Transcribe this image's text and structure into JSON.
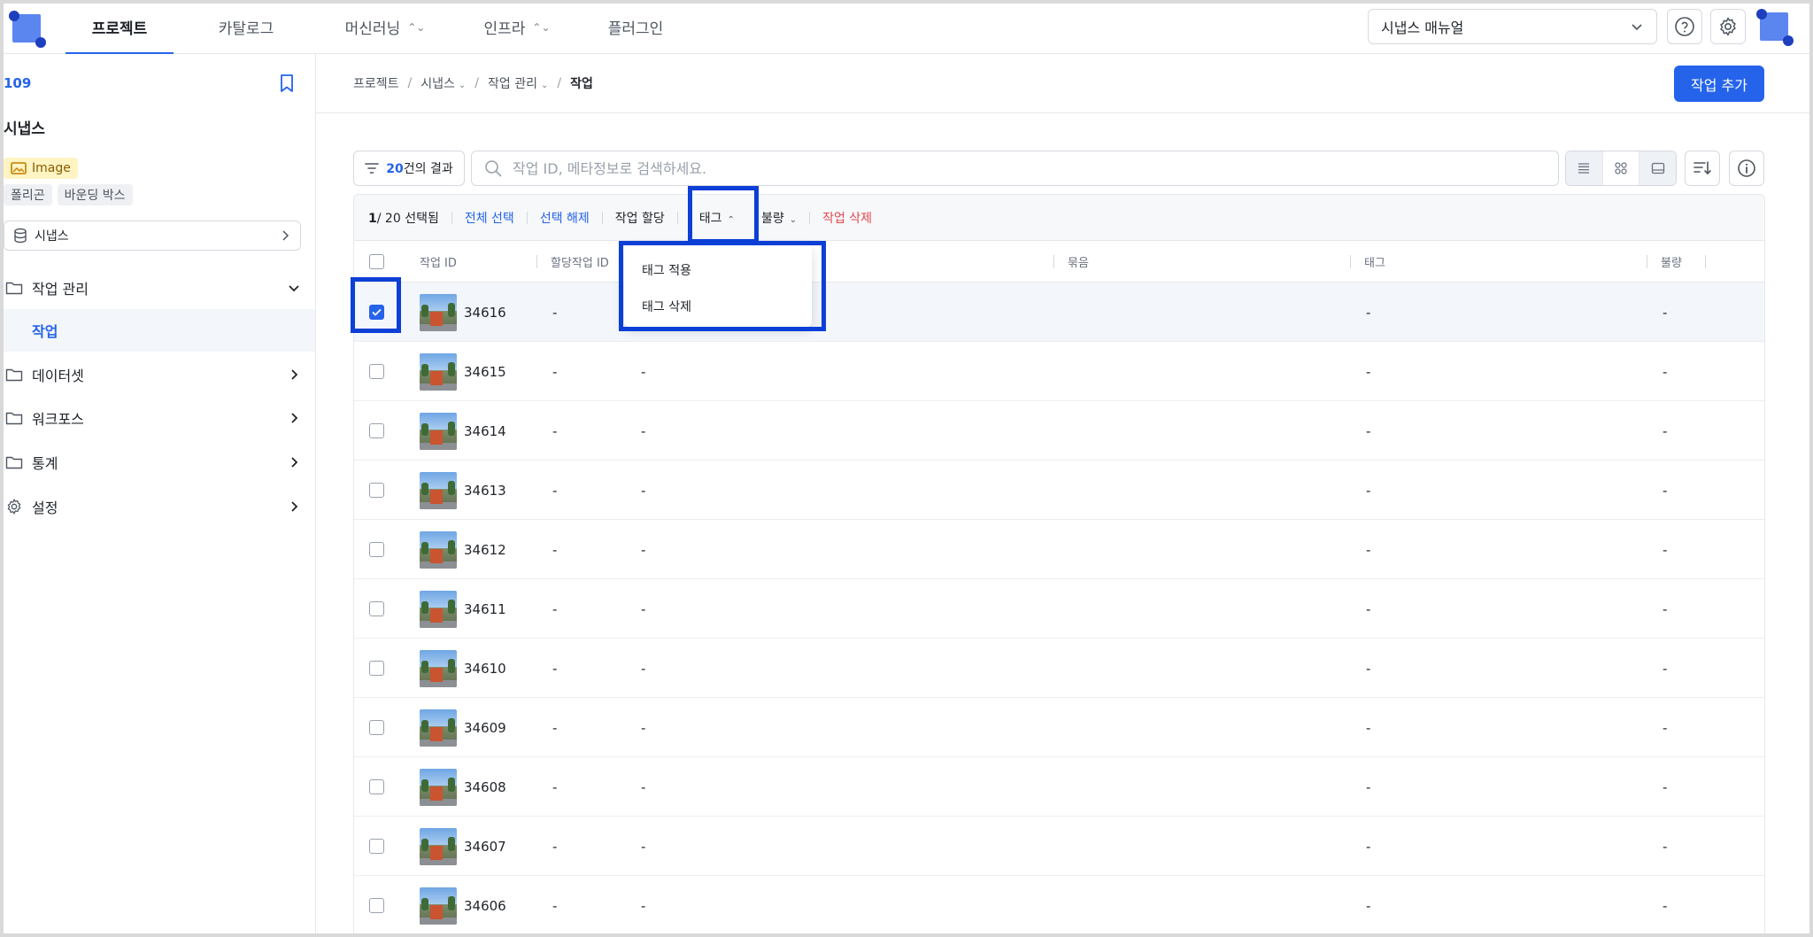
{
  "topnav": {
    "items": [
      {
        "label": "프로젝트",
        "active": true,
        "dropdown": false
      },
      {
        "label": "카탈로그",
        "active": false,
        "dropdown": false
      },
      {
        "label": "머신러닝",
        "active": false,
        "dropdown": true
      },
      {
        "label": "인프라",
        "active": false,
        "dropdown": true
      },
      {
        "label": "플러그인",
        "active": false,
        "dropdown": false
      }
    ],
    "workspace": "시냅스 매뉴얼",
    "help_icon": "question-circle-icon",
    "settings_icon": "gear-icon"
  },
  "sidebar": {
    "project_id": "109",
    "project_name": "시냅스",
    "data_type_badge": "Image",
    "annotation_types": [
      "폴리곤",
      "바운딩 박스"
    ],
    "dataset": "시냅스",
    "menu": [
      {
        "label": "작업 관리",
        "icon": "folder-icon",
        "expanded": true
      },
      {
        "label": "데이터셋",
        "icon": "folder-icon",
        "expanded": false
      },
      {
        "label": "워크포스",
        "icon": "folder-icon",
        "expanded": false
      },
      {
        "label": "통계",
        "icon": "folder-icon",
        "expanded": false
      },
      {
        "label": "설정",
        "icon": "gear-icon",
        "expanded": false
      }
    ],
    "submenu_active": "작업"
  },
  "breadcrumb": {
    "items": [
      "프로젝트",
      "시냅스",
      "작업 관리",
      "작업"
    ]
  },
  "header": {
    "add_button": "작업 추가"
  },
  "filter": {
    "count": "20",
    "suffix": "건의 결과"
  },
  "search": {
    "placeholder": "작업 ID, 메타정보로 검색하세요."
  },
  "actionbar": {
    "selected": "1",
    "total": "/ 20",
    "selected_suffix": "선택됨",
    "select_all": "전체 선택",
    "deselect": "선택 해제",
    "assign": "작업 할당",
    "tag": "태그",
    "defect": "불량",
    "delete": "작업 삭제"
  },
  "table": {
    "headers": {
      "id": "작업 ID",
      "assigned": "할당작업 ID",
      "bundle": "묶음",
      "tag": "태그",
      "defect": "불량"
    },
    "rows": [
      {
        "id": "34616",
        "assigned": "-",
        "col3": "",
        "tag": "-",
        "defect": "-",
        "checked": true
      },
      {
        "id": "34615",
        "assigned": "-",
        "col3": "-",
        "tag": "-",
        "defect": "-",
        "checked": false
      },
      {
        "id": "34614",
        "assigned": "-",
        "col3": "-",
        "tag": "-",
        "defect": "-",
        "checked": false
      },
      {
        "id": "34613",
        "assigned": "-",
        "col3": "-",
        "tag": "-",
        "defect": "-",
        "checked": false
      },
      {
        "id": "34612",
        "assigned": "-",
        "col3": "-",
        "tag": "-",
        "defect": "-",
        "checked": false
      },
      {
        "id": "34611",
        "assigned": "-",
        "col3": "-",
        "tag": "-",
        "defect": "-",
        "checked": false
      },
      {
        "id": "34610",
        "assigned": "-",
        "col3": "-",
        "tag": "-",
        "defect": "-",
        "checked": false
      },
      {
        "id": "34609",
        "assigned": "-",
        "col3": "-",
        "tag": "-",
        "defect": "-",
        "checked": false
      },
      {
        "id": "34608",
        "assigned": "-",
        "col3": "-",
        "tag": "-",
        "defect": "-",
        "checked": false
      },
      {
        "id": "34607",
        "assigned": "-",
        "col3": "-",
        "tag": "-",
        "defect": "-",
        "checked": false
      },
      {
        "id": "34606",
        "assigned": "-",
        "col3": "-",
        "tag": "-",
        "defect": "-",
        "checked": false
      }
    ]
  },
  "tag_dropdown": {
    "apply": "태그 적용",
    "remove": "태그 삭제"
  },
  "colors": {
    "accent": "#2563eb",
    "highlight": "#0b3fd6",
    "danger": "#e5484d"
  }
}
